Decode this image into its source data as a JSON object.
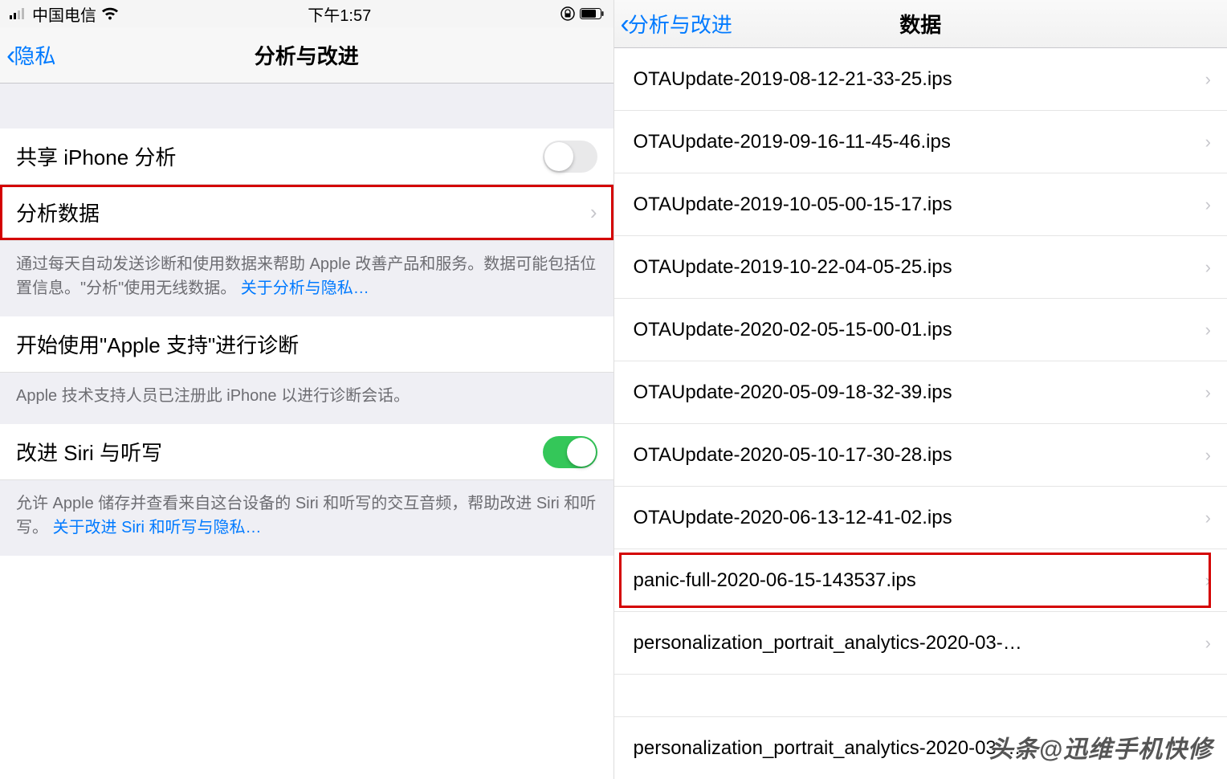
{
  "statusBar": {
    "carrier": "中国电信",
    "time": "下午1:57"
  },
  "left": {
    "back": "隐私",
    "title": "分析与改进",
    "shareCell": "共享 iPhone 分析",
    "analyticsDataCell": "分析数据",
    "footer1": "通过每天自动发送诊断和使用数据来帮助 Apple 改善产品和服务。数据可能包括位置信息。\"分析\"使用无线数据。",
    "footer1Link": "关于分析与隐私…",
    "supportCell": "开始使用\"Apple 支持\"进行诊断",
    "footer2": "Apple 技术支持人员已注册此 iPhone 以进行诊断会话。",
    "siriCell": "改进 Siri 与听写",
    "footer3": "允许 Apple 储存并查看来自这台设备的 Siri 和听写的交互音频，帮助改进 Siri 和听写。",
    "footer3Link": "关于改进 Siri 和听写与隐私…"
  },
  "right": {
    "back": "分析与改进",
    "title": "数据",
    "files": [
      "OTAUpdate-2019-08-12-21-33-25.ips",
      "OTAUpdate-2019-09-16-11-45-46.ips",
      "OTAUpdate-2019-10-05-00-15-17.ips",
      "OTAUpdate-2019-10-22-04-05-25.ips",
      "OTAUpdate-2020-02-05-15-00-01.ips",
      "OTAUpdate-2020-05-09-18-32-39.ips",
      "OTAUpdate-2020-05-10-17-30-28.ips",
      "OTAUpdate-2020-06-13-12-41-02.ips",
      "panic-full-2020-06-15-143537.ips",
      "personalization_portrait_analytics-2020-03-…"
    ],
    "highlightIndex": 8,
    "fadeRow": "personalization_portrait_analytics-2020-03 …"
  },
  "watermark": "头条@迅维手机快修"
}
